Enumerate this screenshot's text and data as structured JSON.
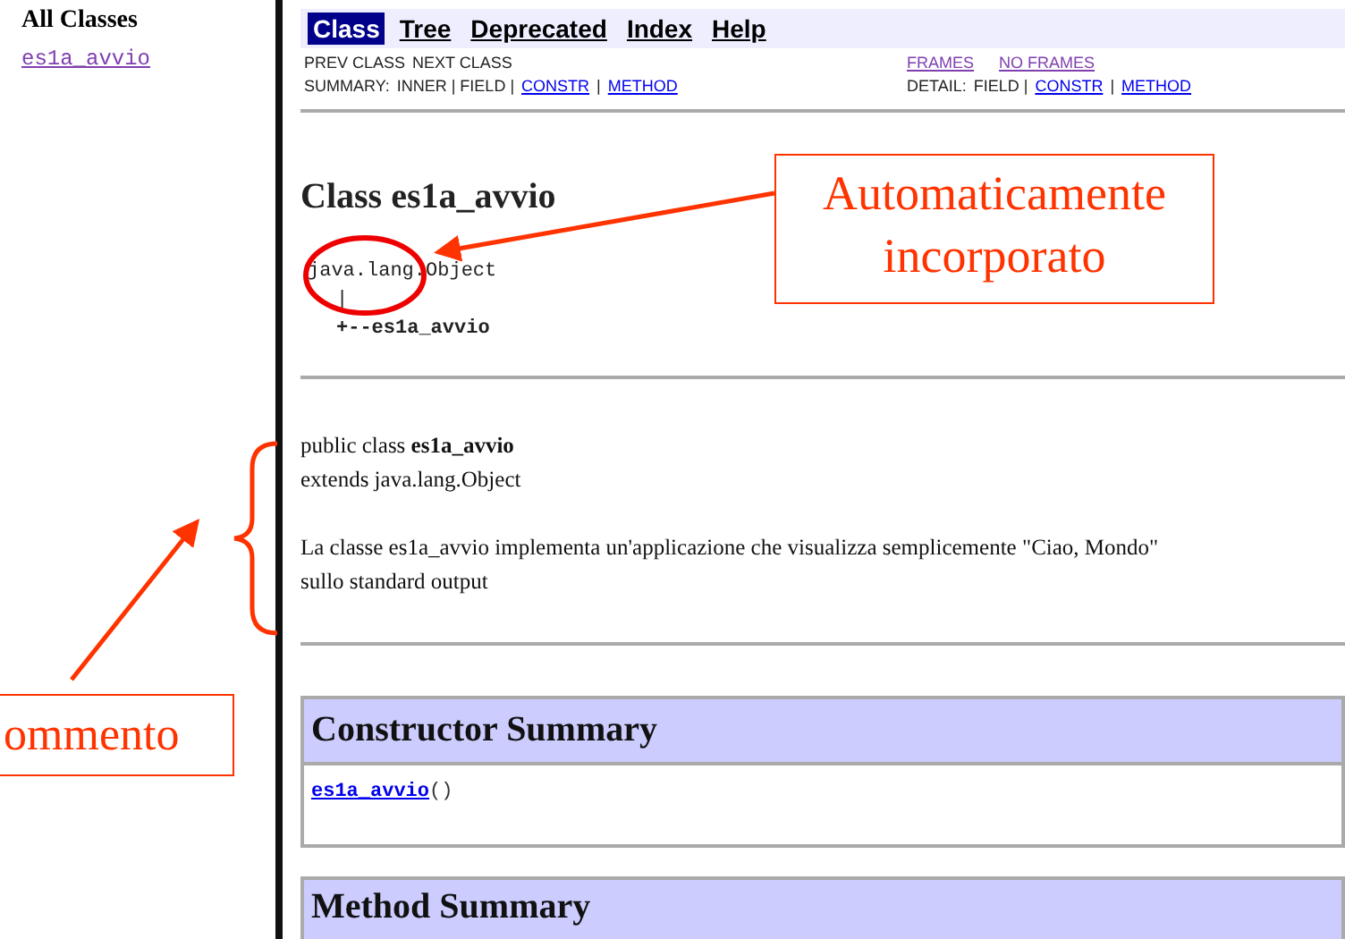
{
  "left_frame": {
    "title": "All Classes",
    "classes": [
      {
        "label": "es1a_avvio"
      }
    ]
  },
  "nav_bar": {
    "tabs": [
      {
        "label": "Class",
        "selected": true
      },
      {
        "label": "Tree",
        "selected": false
      },
      {
        "label": "Deprecated",
        "selected": false
      },
      {
        "label": "Index",
        "selected": false
      },
      {
        "label": "Help",
        "selected": false
      }
    ]
  },
  "sub_nav": {
    "rows": [
      {
        "left": [
          {
            "label": "PREV CLASS",
            "kind": "text"
          },
          {
            "label": "NEXT CLASS",
            "kind": "text"
          }
        ],
        "right": [
          {
            "label": "FRAMES",
            "kind": "visited"
          },
          {
            "label": "NO FRAMES",
            "kind": "visited"
          }
        ]
      },
      {
        "left": [
          {
            "label": "SUMMARY:",
            "kind": "text"
          },
          {
            "label": "INNER | FIELD |",
            "kind": "text"
          },
          {
            "label": "CONSTR",
            "kind": "link"
          },
          {
            "label": "|",
            "kind": "text"
          },
          {
            "label": "METHOD",
            "kind": "link"
          }
        ],
        "right": [
          {
            "label": "DETAIL:",
            "kind": "text"
          },
          {
            "label": "FIELD |",
            "kind": "text"
          },
          {
            "label": "CONSTR",
            "kind": "link"
          },
          {
            "label": "|",
            "kind": "text"
          },
          {
            "label": "METHOD",
            "kind": "link"
          }
        ]
      }
    ]
  },
  "class_title": "Class es1a_avvio",
  "hierarchy": {
    "parent": "java.lang.Object",
    "connector": "|",
    "child": "+--es1a_avvio"
  },
  "declaration": [
    "public class **es1a_avvio**",
    "extends java.lang.Object"
  ],
  "description": [
    "La classe es1a_avvio implementa un'applicazione che visualizza semplicemente \"Ciao, Mondo\"",
    "sullo standard output"
  ],
  "constructor_summary": {
    "title": "Constructor Summary",
    "rows": [
      {
        "name": "es1a_avvio",
        "params": "()"
      }
    ]
  },
  "method_summary": {
    "title": "Method Summary"
  },
  "annotations": [
    {
      "kind": "callout",
      "text": "Automaticamente incorporato"
    },
    {
      "kind": "label",
      "text": "ommento"
    }
  ]
}
